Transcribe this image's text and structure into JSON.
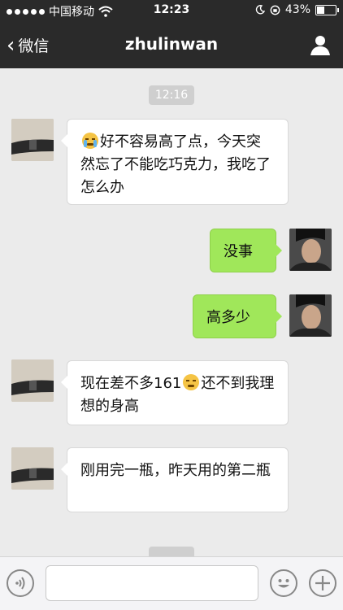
{
  "status_bar": {
    "carrier": "中国移动",
    "time": "12:23",
    "battery": "43%",
    "battery_level": 0.43
  },
  "nav": {
    "back_label": "微信",
    "title": "zhulinwan"
  },
  "timestamps": [
    "12:16"
  ],
  "messages": [
    {
      "side": "in",
      "text": "好不容易高了点，今天突然忘了不能吃巧克力，我吃了怎么办",
      "emoji": "crying"
    },
    {
      "side": "out",
      "text": "没事"
    },
    {
      "side": "out",
      "text": "高多少"
    },
    {
      "side": "in",
      "text_a": "现在差不多161",
      "text_b": "还不到我理想的身高",
      "emoji": "pensive"
    },
    {
      "side": "in",
      "text": "刚用完一瓶，昨天用的第二瓶"
    }
  ],
  "input_bar": {
    "placeholder": "",
    "icons": [
      "voice-icon",
      "emoji-icon",
      "plus-icon"
    ]
  },
  "colors": {
    "bar_dark": "#2a2a2a",
    "chat_bg": "#ebebeb",
    "outgoing_bubble": "#a0e75a",
    "incoming_bubble": "#ffffff"
  }
}
